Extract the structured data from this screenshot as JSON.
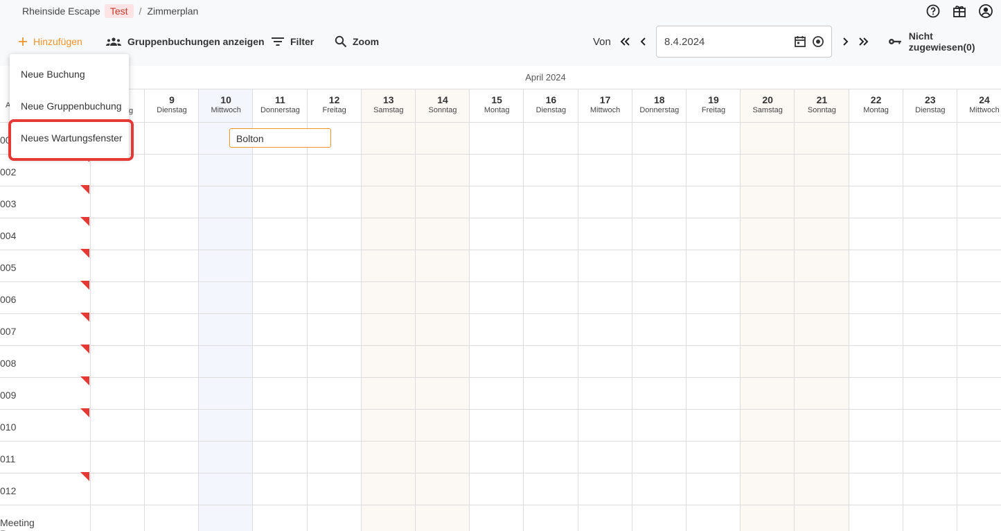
{
  "breadcrumb": {
    "org": "Rheinside Escape",
    "tag": "Test",
    "page": "Zimmerplan"
  },
  "toolbar": {
    "add_label": "Hinzufügen",
    "groups_label": "Gruppenbuchungen anzeigen",
    "filter_label": "Filter",
    "zoom_label": "Zoom",
    "from_label": "Von",
    "date_value": "8.4.2024",
    "unassigned_label": "Nicht zugewiesen(0)"
  },
  "menu": {
    "items": [
      "Neue Buchung",
      "Neue Gruppenbuchung",
      "Neues Wartungsfenster"
    ]
  },
  "calendar": {
    "month": "April 2024",
    "first_col_partial_header": "A",
    "first_col_partial_day": "g",
    "days": [
      {
        "num": "9",
        "name": "Dienstag"
      },
      {
        "num": "10",
        "name": "Mittwoch"
      },
      {
        "num": "11",
        "name": "Donnerstag"
      },
      {
        "num": "12",
        "name": "Freitag"
      },
      {
        "num": "13",
        "name": "Samstag"
      },
      {
        "num": "14",
        "name": "Sonntag"
      },
      {
        "num": "15",
        "name": "Montag"
      },
      {
        "num": "16",
        "name": "Dienstag"
      },
      {
        "num": "17",
        "name": "Mittwoch"
      },
      {
        "num": "18",
        "name": "Donnerstag"
      },
      {
        "num": "19",
        "name": "Freitag"
      },
      {
        "num": "20",
        "name": "Samstag"
      },
      {
        "num": "21",
        "name": "Sonntag"
      },
      {
        "num": "22",
        "name": "Montag"
      },
      {
        "num": "23",
        "name": "Dienstag"
      },
      {
        "num": "24",
        "name": "Mittwoch"
      }
    ],
    "rooms": [
      "00",
      "002",
      "003",
      "004",
      "005",
      "006",
      "007",
      "008",
      "009",
      "010",
      "011",
      "012",
      "Meeting Room"
    ],
    "booking": "Bolton"
  },
  "colors": {
    "accent": "#f0932b",
    "flag": "#e53935",
    "highlight": "#e53935"
  }
}
